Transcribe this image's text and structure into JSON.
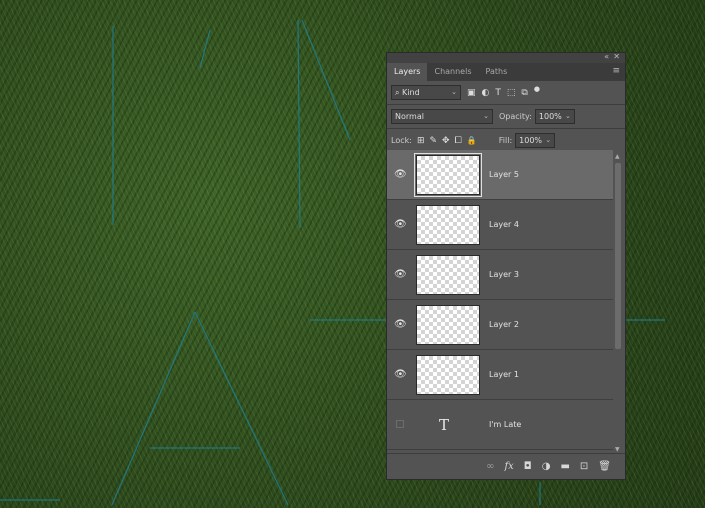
{
  "panel": {
    "collapse_icon": "«",
    "close_icon": "✕",
    "menu_icon": "≡",
    "tabs": [
      {
        "label": "Layers",
        "active": true
      },
      {
        "label": "Channels",
        "active": false
      },
      {
        "label": "Paths",
        "active": false
      }
    ]
  },
  "filter": {
    "search_glyph": "⌕",
    "kind_label": "Kind",
    "dropdown_caret": "⌄",
    "icons": {
      "pixel": "▣",
      "adjustment": "◐",
      "type": "T",
      "shape": "⬚",
      "smart": "⧉",
      "toggle": "●"
    }
  },
  "blend": {
    "mode": "Normal",
    "opacity_label": "Opacity:",
    "opacity_value": "100%"
  },
  "lock": {
    "label": "Lock:",
    "icons": {
      "transparent": "⊞",
      "paint": "✎",
      "move": "✥",
      "artboard": "⧠",
      "all": "🔒"
    },
    "fill_label": "Fill:",
    "fill_value": "100%"
  },
  "layers": [
    {
      "name": "Layer 5",
      "selected": true,
      "visible": true,
      "type": "pixel"
    },
    {
      "name": "Layer 4",
      "selected": false,
      "visible": true,
      "type": "pixel"
    },
    {
      "name": "Layer 3",
      "selected": false,
      "visible": true,
      "type": "pixel"
    },
    {
      "name": "Layer 2",
      "selected": false,
      "visible": true,
      "type": "pixel"
    },
    {
      "name": "Layer 1",
      "selected": false,
      "visible": true,
      "type": "pixel"
    },
    {
      "name": "I'm Late",
      "selected": false,
      "visible": false,
      "type": "text"
    }
  ],
  "layer_icons": {
    "eye": "👁",
    "text_glyph": "T"
  },
  "scroll": {
    "up": "▲",
    "down": "▼"
  },
  "footer": {
    "link": "∞",
    "fx": "fx",
    "mask": "◘",
    "adjust": "◑",
    "group": "▬",
    "new": "⊡",
    "delete": "🗑"
  },
  "colors": {
    "panel_bg": "#535353",
    "selected_row": "#6a6a6a",
    "guide": "#1f7f8a"
  }
}
